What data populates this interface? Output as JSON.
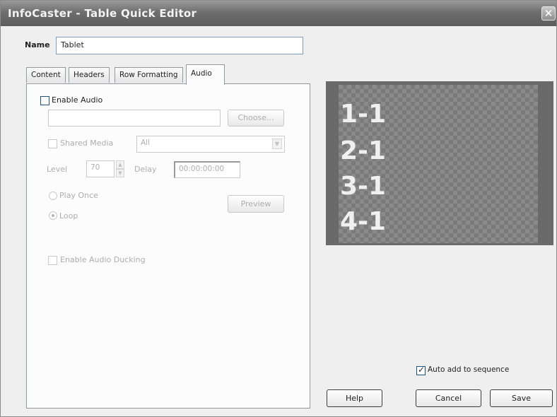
{
  "window": {
    "title": "InfoCaster - Table Quick Editor",
    "close_symbol": "✕"
  },
  "name": {
    "label": "Name",
    "value": "Tablet"
  },
  "tabs": [
    {
      "label": "Content"
    },
    {
      "label": "Headers"
    },
    {
      "label": "Row Formatting"
    },
    {
      "label": "Audio"
    }
  ],
  "audio": {
    "enable_label": "Enable Audio",
    "choose_label": "Choose...",
    "shared_media_label": "Shared Media",
    "shared_media_value": "All",
    "level_label": "Level",
    "level_value": "70",
    "delay_label": "Delay",
    "delay_value": "00:00:00:00",
    "play_once_label": "Play Once",
    "loop_label": "Loop",
    "preview_label": "Preview",
    "ducking_label": "Enable Audio Ducking"
  },
  "preview_rows": [
    "1-1",
    "2-1",
    "3-1",
    "4-1"
  ],
  "footer": {
    "auto_add_label": "Auto add to sequence",
    "help_label": "Help",
    "cancel_label": "Cancel",
    "save_label": "Save"
  }
}
